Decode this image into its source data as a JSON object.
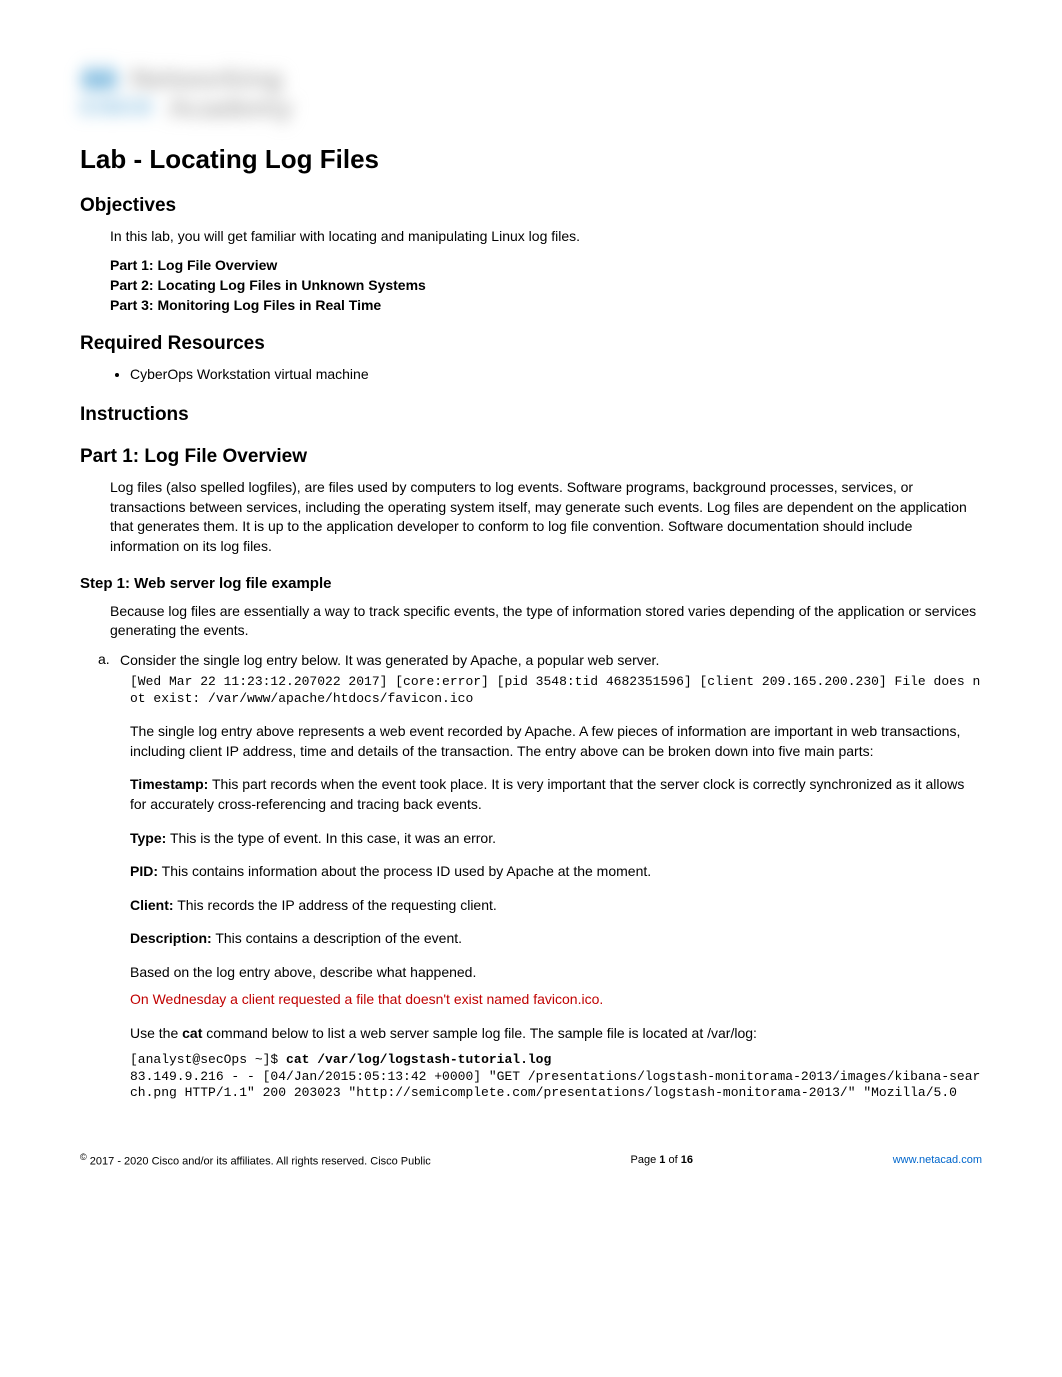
{
  "logo": {
    "top_dots": "ılıılı",
    "networking": "Networking",
    "cisco": "CISCO",
    "academy": "Academy"
  },
  "title": "Lab - Locating Log Files",
  "objectives": {
    "heading": "Objectives",
    "intro": "In this lab, you will get familiar with locating and manipulating Linux log files.",
    "parts": {
      "p1": "Part 1: Log File Overview",
      "p2": "Part 2: Locating Log Files in Unknown Systems",
      "p3": "Part 3: Monitoring Log Files in Real Time"
    }
  },
  "required": {
    "heading": "Required Resources",
    "item1": "CyberOps Workstation virtual machine"
  },
  "instructions": {
    "heading": "Instructions"
  },
  "part1": {
    "heading": "Part 1: Log File Overview",
    "intro": "Log files (also spelled logfiles), are files used by computers to log events. Software programs, background processes, services, or transactions between services, including the operating system itself, may generate such events. Log files are dependent on the application that generates them. It is up to the application developer to conform to log file convention. Software documentation should include information on its log files.",
    "step1": {
      "heading": "Step 1: Web server log file example",
      "intro": "Because log files are essentially a way to track specific events, the type of information stored varies depending of the application or services generating the events.",
      "a_label": "a.",
      "a_text": "Consider the single log entry below. It was generated by Apache, a popular web server.",
      "a_code": "[Wed Mar 22 11:23:12.207022 2017] [core:error] [pid 3548:tid 4682351596] [client 209.165.200.230] File does not exist: /var/www/apache/htdocs/favicon.ico",
      "a_explain": "The single log entry above represents a web event recorded by Apache. A few pieces of information are important in web transactions, including client IP address, time and details of the transaction. The entry above can be broken down into five main parts:",
      "timestamp_label": "Timestamp:",
      "timestamp_text": " This part records when the event took place. It is very important that the server clock is correctly synchronized as it allows for accurately cross-referencing and tracing back events.",
      "type_label": "Type:",
      "type_text": " This is the type of event. In this case, it was an error.",
      "pid_label": "PID:",
      "pid_text": " This contains information about the process ID used by Apache at the moment.",
      "client_label": "Client:",
      "client_text": " This records the IP address of the requesting client.",
      "description_label": "Description:",
      "description_text": " This contains a description of the event.",
      "question": "Based on the log entry above, describe what happened.",
      "answer": "On Wednesday a client requested a file that doesn't exist named favicon.ico.",
      "cat_intro_pre": "Use the ",
      "cat_cmd": "cat",
      "cat_intro_post": " command below to list a web server sample log file. The sample file is located at /var/log:",
      "cat_line_prompt": "[analyst@secOps ~]$ ",
      "cat_line_cmd": "cat /var/log/logstash-tutorial.log",
      "cat_output": "83.149.9.216 - - [04/Jan/2015:05:13:42 +0000] \"GET /presentations/logstash-monitorama-2013/images/kibana-search.png HTTP/1.1\" 200 203023 \"http://semicomplete.com/presentations/logstash-monitorama-2013/\" \"Mozilla/5.0"
    }
  },
  "footer": {
    "copyright_symbol": "©",
    "copyright": " 2017 - 2020 Cisco and/or its affiliates. All rights reserved. Cisco Public",
    "page_pre": "Page ",
    "page_num": "1",
    "page_mid": " of ",
    "page_total": "16",
    "link": "www.netacad.com"
  }
}
